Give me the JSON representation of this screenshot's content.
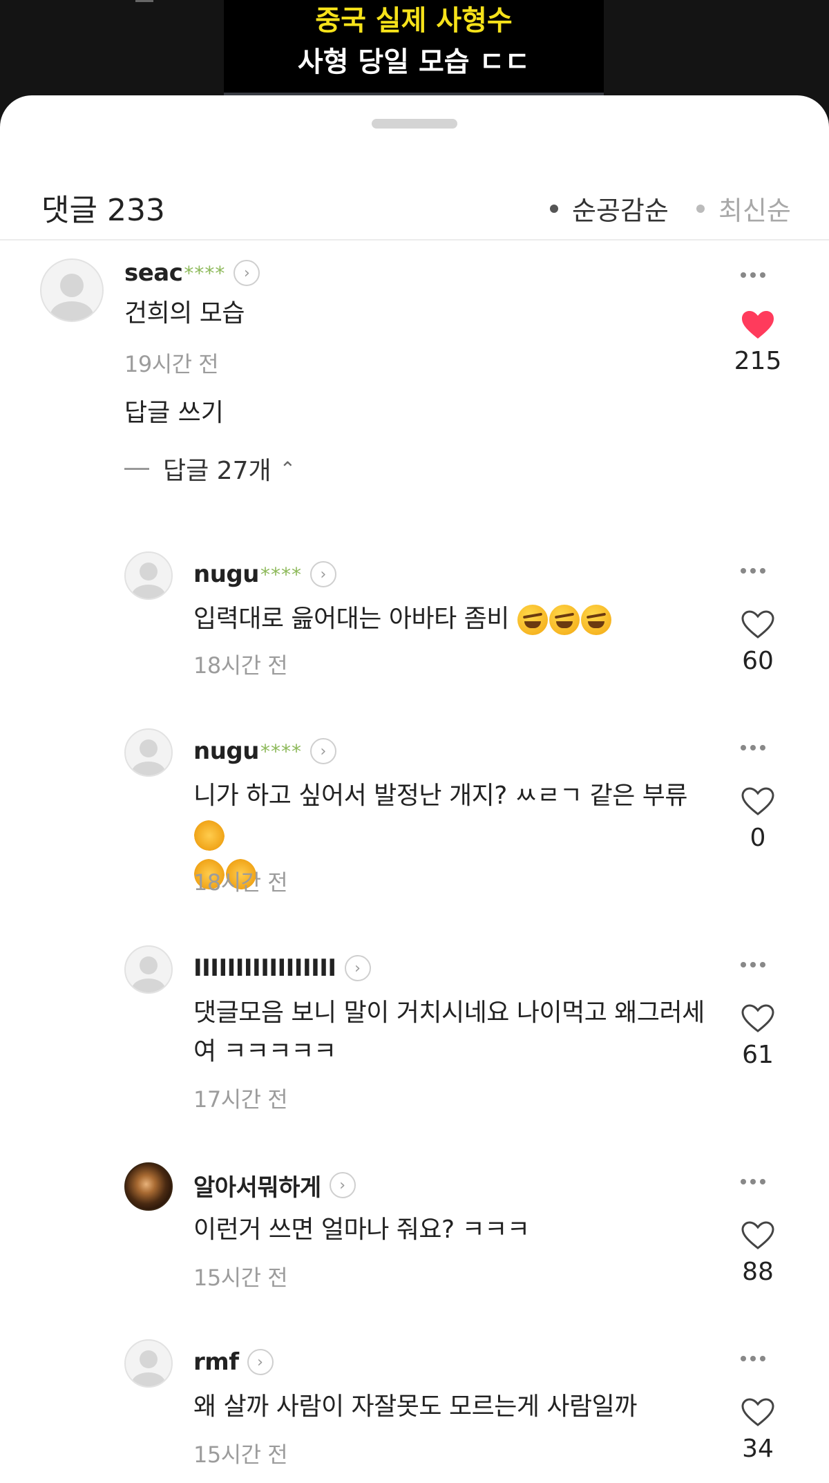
{
  "video": {
    "title_line1": "중국 실제 사형수",
    "title_line2": "사형 당일 모습 ㄷㄷ"
  },
  "header": {
    "title": "댓글 233",
    "sort_popular": "순공감순",
    "sort_latest": "최신순"
  },
  "top_comment": {
    "username": "seac",
    "mask": "****",
    "text": "건희의 모습",
    "time": "19시간 전",
    "likes": "215",
    "liked": true,
    "reply_link": "답글 쓰기",
    "replies_toggle": "답글 27개"
  },
  "replies": [
    {
      "username": "nugu",
      "mask": "****",
      "text": "입력대로 읊어대는 아바타 좀비",
      "emoji": [
        "rofl",
        "rofl",
        "rofl"
      ],
      "time": "18시간 전",
      "likes": "60"
    },
    {
      "username": "nugu",
      "mask": "****",
      "text_line1": "니가 하고 싶어서 발정난 개지? ㅆㄹㄱ 같은 부류",
      "emoji": [
        "clap",
        "clap",
        "clap"
      ],
      "time": "18시간 전",
      "likes": "0"
    },
    {
      "username": "IIIIIIIIIIIIIIIII",
      "mask": "",
      "text_line1": "댓글모음 보니 말이 거치시네요 나이먹고 왜그러세",
      "text_line2": "여 ㅋㅋㅋㅋㅋ",
      "time": "17시간 전",
      "likes": "61"
    },
    {
      "username": "알아서뭐하게",
      "mask": "",
      "text": "이런거 쓰면 얼마나 줘요? ㅋㅋㅋ",
      "time": "15시간 전",
      "likes": "88"
    },
    {
      "username": "rmf",
      "mask": "",
      "text": "왜 살까 사람이 자잘못도 모르는게 사람일까",
      "time": "15시간 전",
      "likes": "34"
    }
  ],
  "colors": {
    "accent_heart": "#ff3b5c",
    "mask_green": "#8db95a",
    "video_title_yellow": "#f6e21a"
  }
}
